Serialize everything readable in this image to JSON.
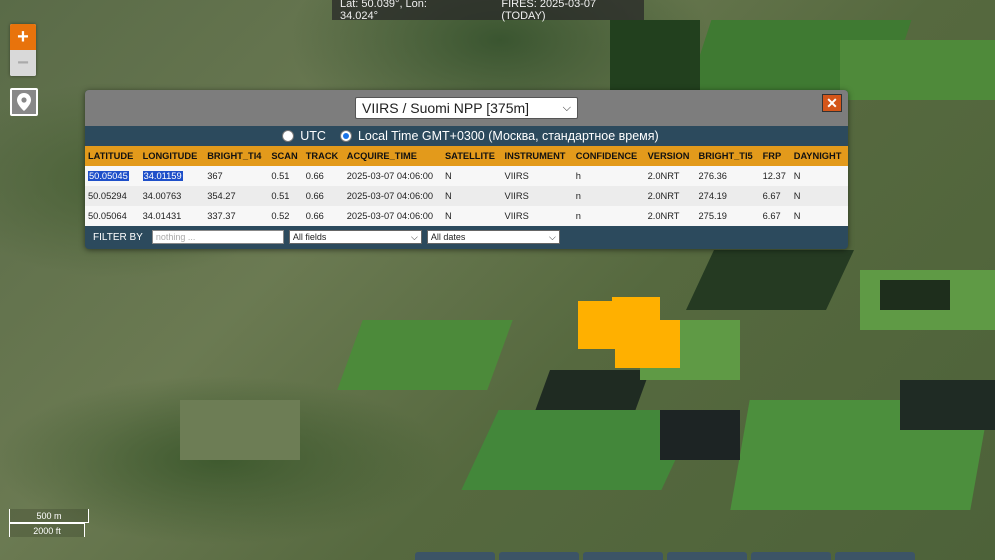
{
  "topbar": {
    "coords": "Lat: 50.039°, Lon: 34.024°",
    "fires": "FIRES: 2025-03-07 (TODAY)"
  },
  "zoom": {
    "in_label": "+",
    "out_label": "−"
  },
  "popup": {
    "satellite_select": "VIIRS / Suomi NPP [375m]",
    "close_label": "✕",
    "time_options": {
      "utc": "UTC",
      "local": "Local Time GMT+0300 (Москва, стандартное время)"
    },
    "columns": [
      "LATITUDE",
      "LONGITUDE",
      "BRIGHT_TI4",
      "SCAN",
      "TRACK",
      "ACQUIRE_TIME",
      "SATELLITE",
      "INSTRUMENT",
      "CONFIDENCE",
      "VERSION",
      "BRIGHT_TI5",
      "FRP",
      "DAYNIGHT"
    ],
    "rows": [
      [
        "50.05045",
        "34.01159",
        "367",
        "0.51",
        "0.66",
        "2025-03-07 04:06:00",
        "N",
        "VIIRS",
        "h",
        "2.0NRT",
        "276.36",
        "12.37",
        "N"
      ],
      [
        "50.05294",
        "34.00763",
        "354.27",
        "0.51",
        "0.66",
        "2025-03-07 04:06:00",
        "N",
        "VIIRS",
        "n",
        "2.0NRT",
        "274.19",
        "6.67",
        "N"
      ],
      [
        "50.05064",
        "34.01431",
        "337.37",
        "0.52",
        "0.66",
        "2025-03-07 04:06:00",
        "N",
        "VIIRS",
        "n",
        "2.0NRT",
        "275.19",
        "6.67",
        "N"
      ]
    ],
    "filter": {
      "label": "FILTER BY",
      "placeholder": "nothing ...",
      "fields_select": "All fields",
      "dates_select": "All dates"
    }
  },
  "scale": {
    "metric": "500 m",
    "imperial": "2000 ft"
  },
  "colors": {
    "fire": "#ffb000",
    "header": "#e39a1b",
    "panel": "#2c4a5d",
    "accent": "#e8730c"
  }
}
